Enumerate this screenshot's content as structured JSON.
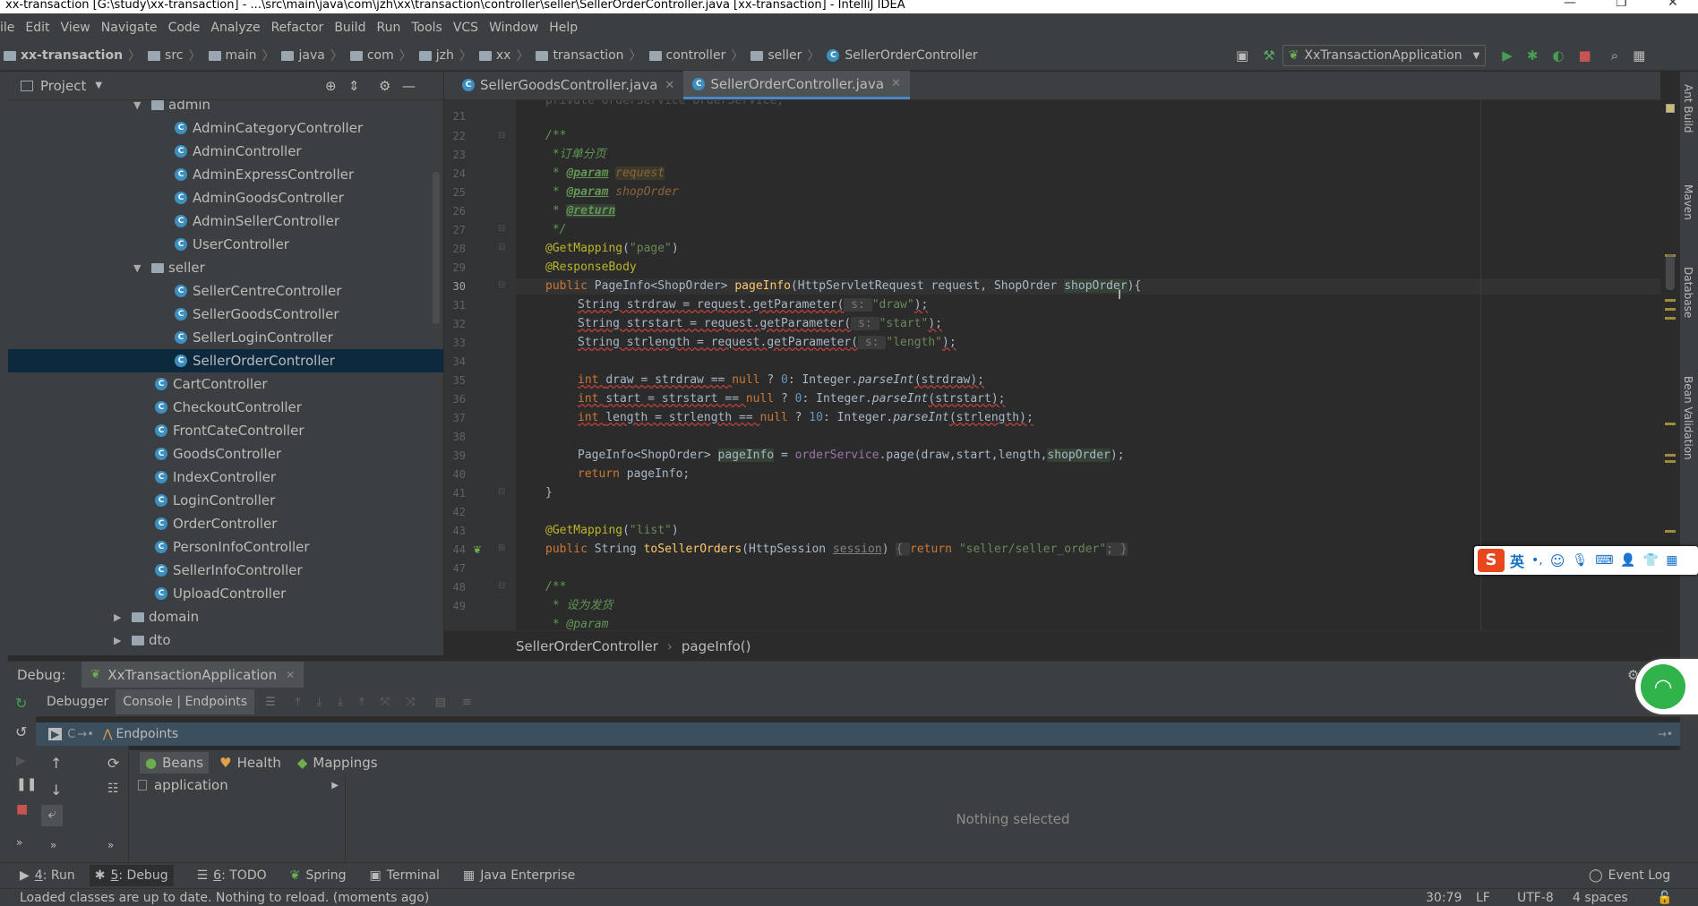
{
  "window": {
    "title": "xx-transaction [G:\\study\\xx-transaction] - ...\\src\\main\\java\\com\\jzh\\xx\\transaction\\controller\\seller\\SellerOrderController.java [xx-transaction] - IntelliJ IDEA"
  },
  "menu": [
    "ile",
    "Edit",
    "View",
    "Navigate",
    "Code",
    "Analyze",
    "Refactor",
    "Build",
    "Run",
    "Tools",
    "VCS",
    "Window",
    "Help"
  ],
  "breadcrumb": [
    "xx-transaction",
    "src",
    "main",
    "java",
    "com",
    "jzh",
    "xx",
    "transaction",
    "controller",
    "seller",
    "SellerOrderController"
  ],
  "run_config": "XxTransactionApplication",
  "project_panel": {
    "title": "Project"
  },
  "tree": [
    {
      "label": "admin",
      "type": "folder",
      "expanded": true
    },
    {
      "label": "AdminCategoryController",
      "type": "class"
    },
    {
      "label": "AdminController",
      "type": "class"
    },
    {
      "label": "AdminExpressController",
      "type": "class"
    },
    {
      "label": "AdminGoodsController",
      "type": "class"
    },
    {
      "label": "AdminSellerController",
      "type": "class"
    },
    {
      "label": "UserController",
      "type": "class"
    },
    {
      "label": "seller",
      "type": "folder",
      "expanded": true
    },
    {
      "label": "SellerCentreController",
      "type": "class"
    },
    {
      "label": "SellerGoodsController",
      "type": "class"
    },
    {
      "label": "SellerLoginController",
      "type": "class"
    },
    {
      "label": "SellerOrderController",
      "type": "class",
      "selected": true
    },
    {
      "label": "CartController",
      "type": "class"
    },
    {
      "label": "CheckoutController",
      "type": "class"
    },
    {
      "label": "FrontCateController",
      "type": "class"
    },
    {
      "label": "GoodsController",
      "type": "class"
    },
    {
      "label": "IndexController",
      "type": "class"
    },
    {
      "label": "LoginController",
      "type": "class"
    },
    {
      "label": "OrderController",
      "type": "class"
    },
    {
      "label": "PersonInfoController",
      "type": "class"
    },
    {
      "label": "SellerInfoController",
      "type": "class"
    },
    {
      "label": "UploadController",
      "type": "class"
    },
    {
      "label": "domain",
      "type": "folder",
      "expanded": false
    },
    {
      "label": "dto",
      "type": "folder",
      "expanded": false
    }
  ],
  "editor_tabs": [
    {
      "label": "SellerGoodsController.java",
      "active": false
    },
    {
      "label": "SellerOrderController.java",
      "active": true
    }
  ],
  "line_numbers": [
    "21",
    "22",
    "23",
    "24",
    "25",
    "26",
    "27",
    "28",
    "29",
    "30",
    "31",
    "32",
    "33",
    "34",
    "35",
    "36",
    "37",
    "38",
    "39",
    "40",
    "41",
    "42",
    "43",
    "44",
    "47",
    "48",
    "49"
  ],
  "code": {
    "l21": "private OrderService orderService;",
    "l22": "/**",
    "l23a": " *",
    "l23b": "订单分页",
    "l24a": " * ",
    "l24tag": "@param",
    "l24p": "request",
    "l25a": " * ",
    "l25tag": "@param",
    "l25p": "shopOrder",
    "l26a": " * ",
    "l26tag": "@return",
    "l27": " */",
    "l28a": "@GetMapping",
    "l28b": "(",
    "l28c": "\"page\"",
    "l28d": ")",
    "l29": "@ResponseBody",
    "l30a": "public ",
    "l30b": "PageInfo<ShopOrder> ",
    "l30c": "pageInfo",
    "l30d": "(HttpServletRequest request, ShopOrder ",
    "l30e": "shopOrder",
    "l30f": "){",
    "l31a": "String strdraw = request.getParameter(",
    "l31h": " s: ",
    "l31s": "\"draw\"",
    "l31e": ");",
    "l32a": "String strstart = request.getParameter(",
    "l32h": " s: ",
    "l32s": "\"start\"",
    "l32e": ");",
    "l33a": "String strlength = request.getParameter(",
    "l33h": " s: ",
    "l33s": "\"length\"",
    "l33e": ");",
    "l35k": "int ",
    "l35a": "draw = strdraw == ",
    "l35n": "null",
    "l35b": " ? ",
    "l35z": "0",
    "l35c": ": Integer.",
    "l35i": "parseInt",
    "l35d": "(strdraw);",
    "l36k": "int ",
    "l36a": "start = strstart == ",
    "l36n": "null",
    "l36b": " ? ",
    "l36z": "0",
    "l36c": ": Integer.",
    "l36i": "parseInt",
    "l36d": "(strstart);",
    "l37k": "int ",
    "l37a": "length = strlength == ",
    "l37n": "null",
    "l37b": " ? ",
    "l37z": "10",
    "l37c": ": Integer.",
    "l37i": "parseInt",
    "l37d": "(strlength);",
    "l39a": "PageInfo<ShopOrder> ",
    "l39b": "pageInfo",
    "l39c": " = ",
    "l39d": "orderService",
    "l39e": ".page(draw,start,length,",
    "l39f": "shopOrder",
    "l39g": ");",
    "l40k": "return ",
    "l40a": "pageInfo;",
    "l41": "}",
    "l43a": "@GetMapping",
    "l43b": "(",
    "l43c": "\"list\"",
    "l43d": ")",
    "l44a": "public ",
    "l44b": "String ",
    "l44c": "toSellerOrders",
    "l44d": "(HttpSession ",
    "l44e": "session",
    "l44f": ") ",
    "l44g": "{ ",
    "l44h": "return ",
    "l44i": "\"seller/seller_order\"",
    "l44j": "; }",
    "l48": "/**",
    "l49a": " * ",
    "l49b": "设为发货",
    "l50": " * @param"
  },
  "code_breadcrumb": [
    "SellerOrderController",
    "pageInfo()"
  ],
  "debug": {
    "label": "Debug:",
    "session": "XxTransactionApplication",
    "tabs": [
      "Debugger",
      "Console | Endpoints"
    ],
    "console_label": "C",
    "endpoints_label": "Endpoints",
    "endpoint_tabs": [
      "Beans",
      "Health",
      "Mappings"
    ],
    "list_item": "application",
    "empty": "Nothing selected"
  },
  "right_tools": [
    "Ant Build",
    "Maven",
    "Database",
    "Bean Validation"
  ],
  "ime": {
    "label": "英"
  },
  "toolwindows": [
    {
      "num": "4",
      "label": ": Run"
    },
    {
      "num": "5",
      "label": ": Debug"
    },
    {
      "num": "6",
      "label": ": TODO"
    },
    {
      "num": "",
      "label": "Spring"
    },
    {
      "num": "",
      "label": "Terminal"
    },
    {
      "num": "",
      "label": "Java Enterprise"
    }
  ],
  "event_log": "Event Log",
  "status": {
    "message": "Loaded classes are up to date. Nothing to reload. (moments ago)",
    "pos": "30:79",
    "lf": "LF",
    "enc": "UTF-8",
    "indent": "4 spaces"
  }
}
